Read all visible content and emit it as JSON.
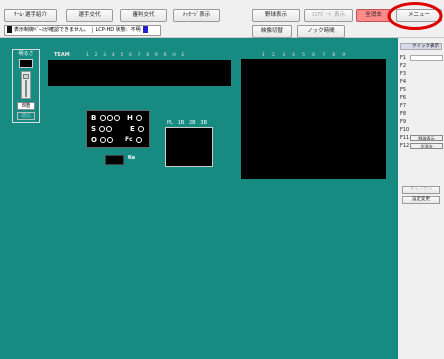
{
  "toolbar": {
    "team_player_intro": "ﾁｰﾑ･選手紹介",
    "player_change": "選手交代",
    "umpire_change": "審判交代",
    "message_display": "ﾒｯｾｰｼﾞ表示",
    "fielder_display": "野球表示",
    "scoreboard_display": "ｽｺｱﾎﾞｰﾄﾞ表示",
    "clear_all": "全消去",
    "menu": "メニュー",
    "video_switch": "映像切替",
    "knock_time": "ノック時間"
  },
  "status_bar": {
    "message": "表示制御ﾍﾞｰｽが確認できません。",
    "lcp_label": "LCP-HD 状態：",
    "lcp_value": "不明"
  },
  "left_panel": {
    "title": "明るさ",
    "level_label": "8階",
    "apply_label": "適応"
  },
  "scoreboard": {
    "team_label": "TEAM",
    "innings": [
      "1",
      "2",
      "3",
      "4",
      "5",
      "6",
      "7",
      "8",
      "9",
      "R",
      "H",
      "E"
    ],
    "right_innings": [
      "1",
      "2",
      "3",
      "4",
      "5",
      "6",
      "7",
      "8",
      "9"
    ]
  },
  "bso": {
    "b": "B",
    "s": "S",
    "o": "O",
    "h": "H",
    "e": "E",
    "fc": "Fc"
  },
  "ke_label": "Ke",
  "field": {
    "pl": "PL",
    "b1": "1B",
    "b2": "2B",
    "b3": "3B"
  },
  "quick": {
    "title": "クイック表示",
    "keys": [
      {
        "k": "F1",
        "v": ""
      },
      {
        "k": "F2",
        "v": ""
      },
      {
        "k": "F3",
        "v": ""
      },
      {
        "k": "F4",
        "v": ""
      },
      {
        "k": "F5",
        "v": ""
      },
      {
        "k": "F6",
        "v": ""
      },
      {
        "k": "F7",
        "v": ""
      },
      {
        "k": "F8",
        "v": ""
      },
      {
        "k": "F9",
        "v": ""
      },
      {
        "k": "F10",
        "v": ""
      },
      {
        "k": "F11",
        "v": "野球表示"
      },
      {
        "k": "F12",
        "v": "全消去"
      }
    ],
    "cancel_label": "キャンセル",
    "settings_label": "設定変更"
  },
  "colors": {
    "field_bg": "#178a82",
    "menu_highlight": "#e00000",
    "clear_btn": "#ff8a8a"
  }
}
